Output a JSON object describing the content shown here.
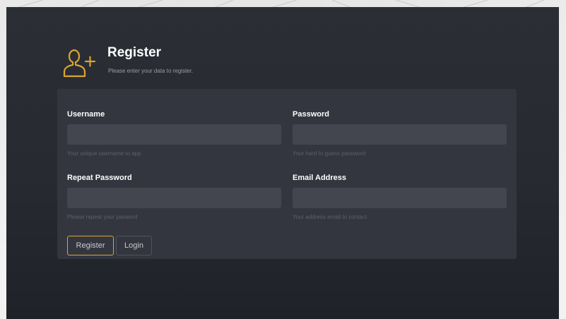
{
  "colors": {
    "accent": "#d9a531",
    "background": "#2b2e35",
    "card": "#33363e",
    "input": "#43464e"
  },
  "header": {
    "icon": "user-add-icon",
    "title": "Register",
    "subtitle": "Please enter your data to register."
  },
  "form": {
    "username": {
      "label": "Username",
      "value": "",
      "help": "Your unique username to app"
    },
    "password": {
      "label": "Password",
      "value": "",
      "help": "Your hard to guess password"
    },
    "repeat_password": {
      "label": "Repeat Password",
      "value": "",
      "help": "Please repeat your pasword"
    },
    "email": {
      "label": "Email Address",
      "value": "",
      "help": "Your address email to contact"
    }
  },
  "buttons": {
    "register": "Register",
    "login": "Login"
  }
}
